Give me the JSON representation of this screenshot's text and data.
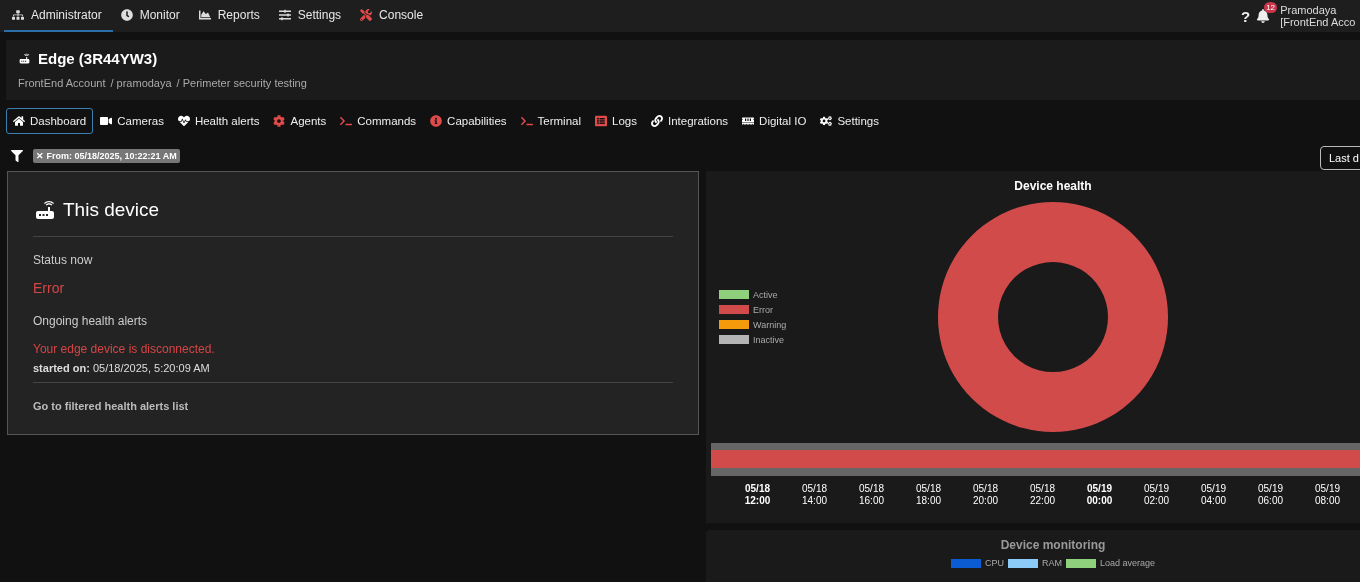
{
  "top_nav": {
    "items": [
      {
        "label": "Administrator",
        "selected": true
      },
      {
        "label": "Monitor",
        "selected": false
      },
      {
        "label": "Reports",
        "selected": false
      },
      {
        "label": "Settings",
        "selected": false
      },
      {
        "label": "Console",
        "selected": false
      }
    ],
    "help": "?",
    "notification_count": "12",
    "user": {
      "name": "Pramodaya",
      "account": "[FrontEnd Acco"
    }
  },
  "header": {
    "title": "Edge (3R44YW3)",
    "breadcrumb": [
      "FrontEnd Account",
      "/ pramodaya",
      "/ Perimeter security testing"
    ]
  },
  "tabs": [
    {
      "label": "Dashboard",
      "selected": true
    },
    {
      "label": "Cameras",
      "selected": false
    },
    {
      "label": "Health alerts",
      "selected": false
    },
    {
      "label": "Agents",
      "selected": false
    },
    {
      "label": "Commands",
      "selected": false
    },
    {
      "label": "Capabilities",
      "selected": false
    },
    {
      "label": "Terminal",
      "selected": false
    },
    {
      "label": "Logs",
      "selected": false
    },
    {
      "label": "Integrations",
      "selected": false
    },
    {
      "label": "Digital IO",
      "selected": false
    },
    {
      "label": "Settings",
      "selected": false
    }
  ],
  "filter": {
    "chip_remove": "✕",
    "chip": "From: 05/18/2025, 10:22:21 AM",
    "range_button": "Last d"
  },
  "device_card": {
    "title": "This device",
    "status_label": "Status now",
    "status_value": "Error",
    "alerts_label": "Ongoing health alerts",
    "alert_message": "Your edge device is disconnected.",
    "started_label": "started on:",
    "started_value": "05/18/2025, 5:20:09 AM",
    "link": "Go to filtered health alerts list"
  },
  "device_health": {
    "title": "Device health",
    "legend": [
      {
        "label": "Active",
        "color": "#8fd07c"
      },
      {
        "label": "Error",
        "color": "#d24b4b"
      },
      {
        "label": "Warning",
        "color": "#f59a0a"
      },
      {
        "label": "Inactive",
        "color": "#b4b4b4"
      }
    ],
    "ticks": [
      {
        "date": "05/18",
        "time": "12:00",
        "major": true
      },
      {
        "date": "05/18",
        "time": "14:00",
        "major": false
      },
      {
        "date": "05/18",
        "time": "16:00",
        "major": false
      },
      {
        "date": "05/18",
        "time": "18:00",
        "major": false
      },
      {
        "date": "05/18",
        "time": "20:00",
        "major": false
      },
      {
        "date": "05/18",
        "time": "22:00",
        "major": false
      },
      {
        "date": "05/19",
        "time": "00:00",
        "major": true
      },
      {
        "date": "05/19",
        "time": "02:00",
        "major": false
      },
      {
        "date": "05/19",
        "time": "04:00",
        "major": false
      },
      {
        "date": "05/19",
        "time": "06:00",
        "major": false
      },
      {
        "date": "05/19",
        "time": "08:00",
        "major": false
      }
    ]
  },
  "device_monitoring": {
    "title": "Device monitoring",
    "legend": [
      {
        "label": "CPU",
        "color": "#0b5bd3"
      },
      {
        "label": "RAM",
        "color": "#8ccaf7"
      },
      {
        "label": "Load average",
        "color": "#8fd07c"
      }
    ]
  }
}
